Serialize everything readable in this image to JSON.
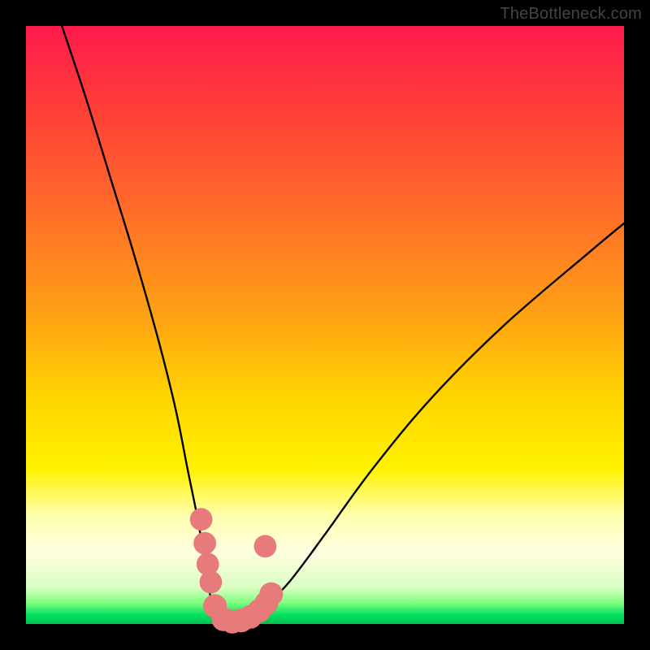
{
  "watermark": "TheBottleneck.com",
  "chart_data": {
    "type": "line",
    "title": "",
    "xlabel": "",
    "ylabel": "",
    "xlim": [
      0,
      100
    ],
    "ylim": [
      0,
      100
    ],
    "series": [
      {
        "name": "bottleneck-curve",
        "x": [
          6,
          10,
          14,
          18,
          22,
          25,
          27,
          29,
          30,
          31,
          32,
          34,
          36,
          38,
          40,
          44,
          50,
          58,
          68,
          80,
          94,
          100
        ],
        "y": [
          100,
          88,
          75,
          62,
          48,
          36,
          26,
          16,
          9,
          4,
          1,
          0,
          0,
          1,
          3,
          7,
          15,
          26,
          38,
          50,
          62,
          67
        ]
      }
    ],
    "markers": {
      "name": "highlighted-points",
      "color": "#e77b7b",
      "points": [
        {
          "x": 29.3,
          "y": 17.5,
          "r": 1.6
        },
        {
          "x": 29.9,
          "y": 13.5,
          "r": 1.6
        },
        {
          "x": 30.4,
          "y": 10.0,
          "r": 1.6
        },
        {
          "x": 30.9,
          "y": 7.0,
          "r": 1.6
        },
        {
          "x": 31.6,
          "y": 3.0,
          "r": 1.8
        },
        {
          "x": 33.0,
          "y": 0.8,
          "r": 1.8
        },
        {
          "x": 34.5,
          "y": 0.4,
          "r": 1.8
        },
        {
          "x": 36.0,
          "y": 0.6,
          "r": 1.8
        },
        {
          "x": 37.5,
          "y": 1.2,
          "r": 1.8
        },
        {
          "x": 39.0,
          "y": 2.2,
          "r": 1.8
        },
        {
          "x": 40.2,
          "y": 3.5,
          "r": 1.8
        },
        {
          "x": 41.0,
          "y": 5.0,
          "r": 1.8
        },
        {
          "x": 40.0,
          "y": 13.0,
          "r": 1.6
        }
      ]
    }
  }
}
